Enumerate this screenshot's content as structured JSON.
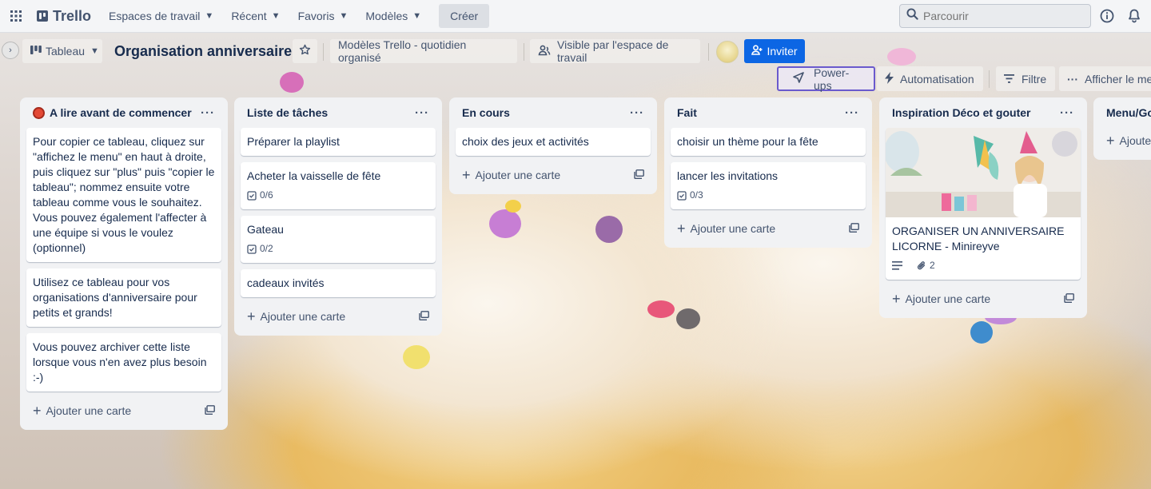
{
  "topbar": {
    "app_name": "Trello",
    "nav": [
      "Espaces de travail",
      "Récent",
      "Favoris",
      "Modèles"
    ],
    "create_label": "Créer",
    "search_placeholder": "Parcourir"
  },
  "board_header": {
    "view_label": "Tableau",
    "title": "Organisation anniversaire",
    "template_label": "Modèles Trello - quotidien organisé",
    "visibility_label": "Visible par l'espace de travail",
    "invite_label": "Inviter",
    "powerups_label": "Power-ups",
    "automation_label": "Automatisation",
    "filter_label": "Filtre",
    "show_menu_label": "Afficher le menu"
  },
  "lists": [
    {
      "title": "A lire avant de commencer",
      "cards": [
        {
          "text": "Pour copier ce tableau, cliquez sur \"affichez le menu\" en haut à droite, puis cliquez sur \"plus\" puis \"copier le tableau\"; nommez ensuite votre tableau comme vous le souhaitez. Vous pouvez également l'affecter à une équipe si vous le voulez (optionnel)"
        },
        {
          "text": "Utilisez ce tableau pour vos organisations d'anniversaire pour petits et grands!"
        },
        {
          "text": "Vous pouvez archiver cette liste lorsque vous n'en avez plus besoin :-)"
        }
      ],
      "add_label": "Ajouter une carte"
    },
    {
      "title": "Liste de tâches",
      "cards": [
        {
          "text": "Préparer la playlist"
        },
        {
          "text": "Acheter la vaisselle de fête",
          "checklist": "0/6"
        },
        {
          "text": "Gateau",
          "checklist": "0/2"
        },
        {
          "text": "cadeaux invités"
        }
      ],
      "add_label": "Ajouter une carte"
    },
    {
      "title": "En cours",
      "cards": [
        {
          "text": "choix des jeux et activités"
        }
      ],
      "add_label": "Ajouter une carte"
    },
    {
      "title": "Fait",
      "cards": [
        {
          "text": "choisir un thème pour la fête"
        },
        {
          "text": "lancer les invitations",
          "checklist": "0/3"
        }
      ],
      "add_label": "Ajouter une carte"
    },
    {
      "title": "Inspiration Déco et gouter",
      "cards": [
        {
          "text": "ORGANISER UN ANNIVERSAIRE LICORNE - Minireyve",
          "attachments": "2",
          "has_description": true,
          "has_cover": true
        }
      ],
      "add_label": "Ajouter une carte"
    },
    {
      "title": "Menu/Go",
      "add_label": "Ajoute"
    }
  ],
  "colors": {
    "accent": "#0c66e4",
    "list_bg": "#f1f2f4",
    "powerups_border": "#6a5acd",
    "label_red": "#e34935"
  }
}
